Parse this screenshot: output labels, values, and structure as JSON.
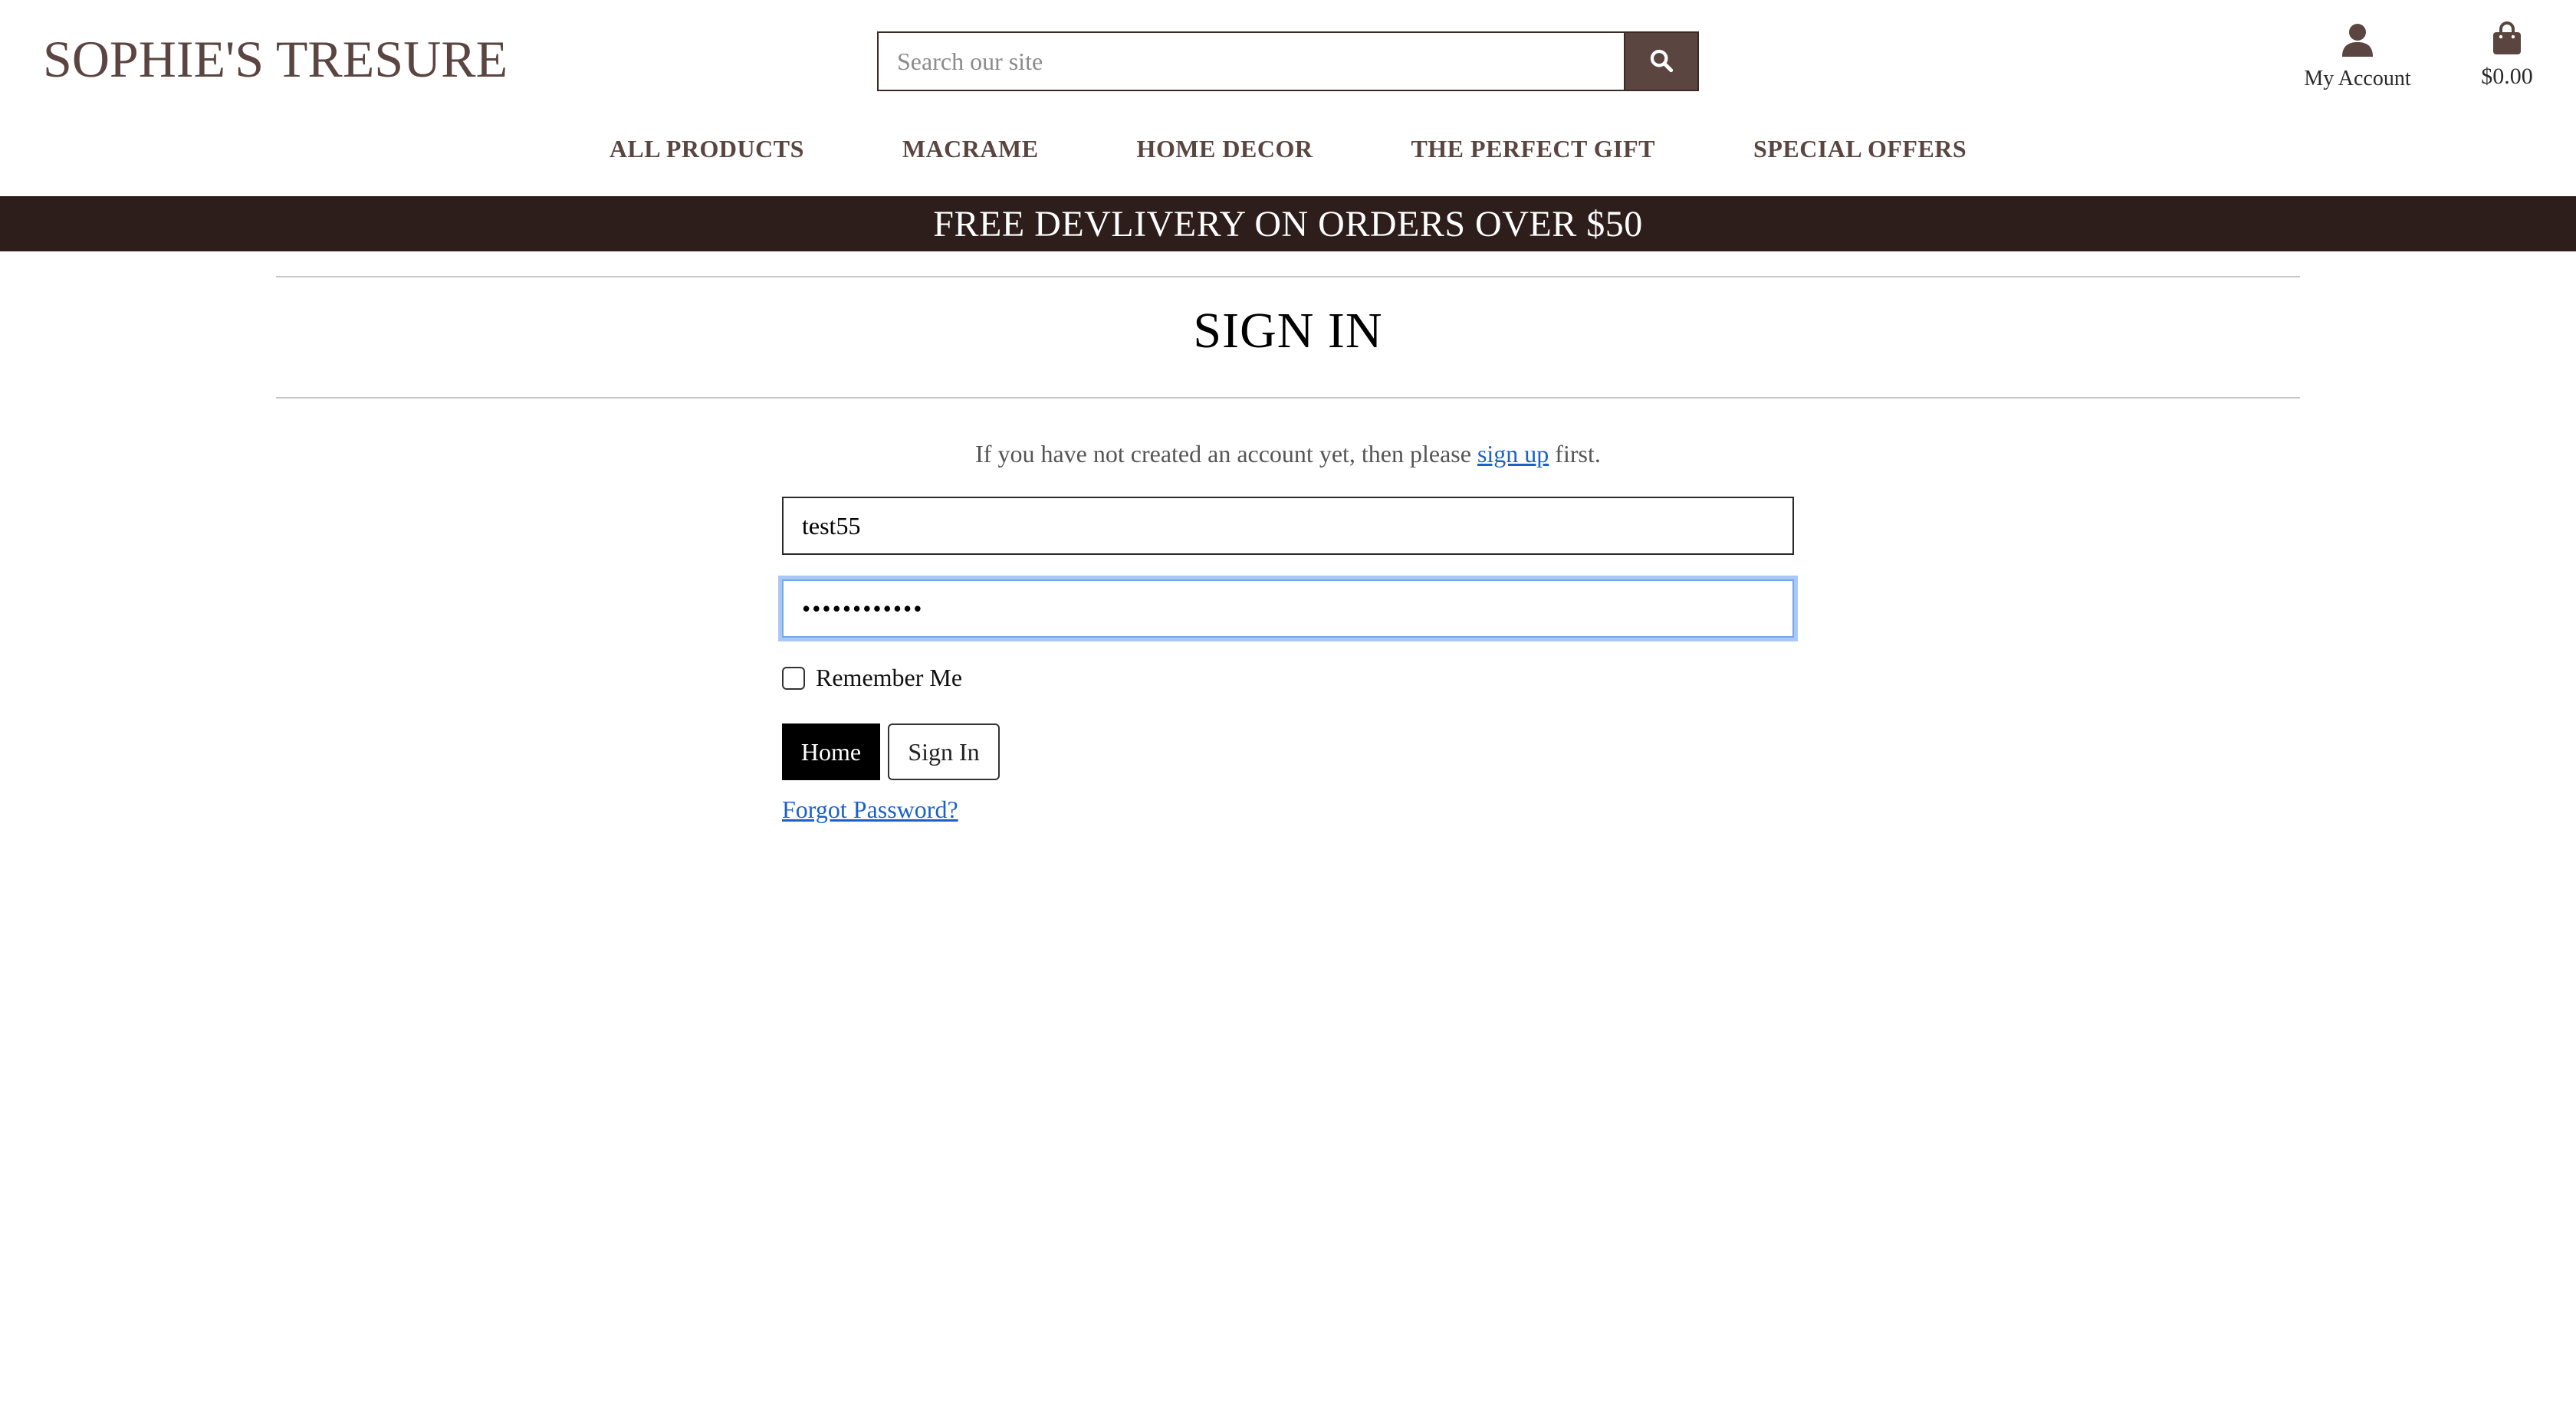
{
  "header": {
    "logo": "SOPHIE'S TRESURE",
    "search_placeholder": "Search our site",
    "account_label": "My Account",
    "cart_total": "$0.00"
  },
  "nav": {
    "items": [
      {
        "label": "ALL PRODUCTS"
      },
      {
        "label": "MACRAME"
      },
      {
        "label": "HOME DECOR"
      },
      {
        "label": "THE PERFECT GIFT"
      },
      {
        "label": "SPECIAL OFFERS"
      }
    ]
  },
  "banner": {
    "text": "FREE DEVLIVERY ON ORDERS OVER $50"
  },
  "signin": {
    "title": "SIGN IN",
    "intro_before": "If you have not created an account yet, then please ",
    "intro_link": "sign up",
    "intro_after": " first.",
    "username_value": "test55",
    "password_value": "••••••••••••",
    "remember_label": "Remember Me",
    "home_button": "Home",
    "signin_button": "Sign In",
    "forgot_link": "Forgot Password?"
  },
  "colors": {
    "brand_brown": "#5a4540",
    "banner_bg": "#2d1d1b",
    "link_blue": "#1a62c9",
    "focus_ring": "#a9c9f5"
  },
  "icons": {
    "search": "search-icon",
    "account": "user-icon",
    "cart": "shopping-bag-icon"
  }
}
